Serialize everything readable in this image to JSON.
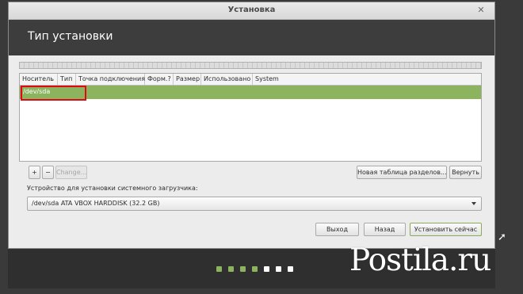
{
  "window": {
    "title": "Установка",
    "close_glyph": "✕"
  },
  "header": {
    "title": "Тип установки"
  },
  "table": {
    "columns": [
      "Носитель",
      "Тип",
      "Точка подключения",
      "Форм.?",
      "Размер",
      "Использовано",
      "System"
    ],
    "rows": [
      {
        "device": "/dev/sda",
        "selected": true
      }
    ]
  },
  "partition_toolbar": {
    "add_label": "+",
    "remove_label": "−",
    "change_label": "Change..."
  },
  "actions": {
    "new_table_label": "Новая таблица разделов...",
    "revert_label": "Вернуть"
  },
  "bootloader": {
    "label": "Устройство для установки системного загрузчика:",
    "selected_value": "/dev/sda   ATA VBOX HARDDISK (32.2 GB)"
  },
  "buttons": {
    "quit_label": "Выход",
    "back_label": "Назад",
    "install_label": "Установить сейчас"
  },
  "progress": {
    "steps_total": 7,
    "steps_done": 4,
    "done_color": "#8cb35e",
    "todo_color": "#ffffff"
  },
  "watermark": {
    "text": "Postila.ru"
  },
  "colors": {
    "accent": "#8cb35e",
    "highlight_border": "#e30613",
    "header_bg": "#3d3d3d"
  }
}
